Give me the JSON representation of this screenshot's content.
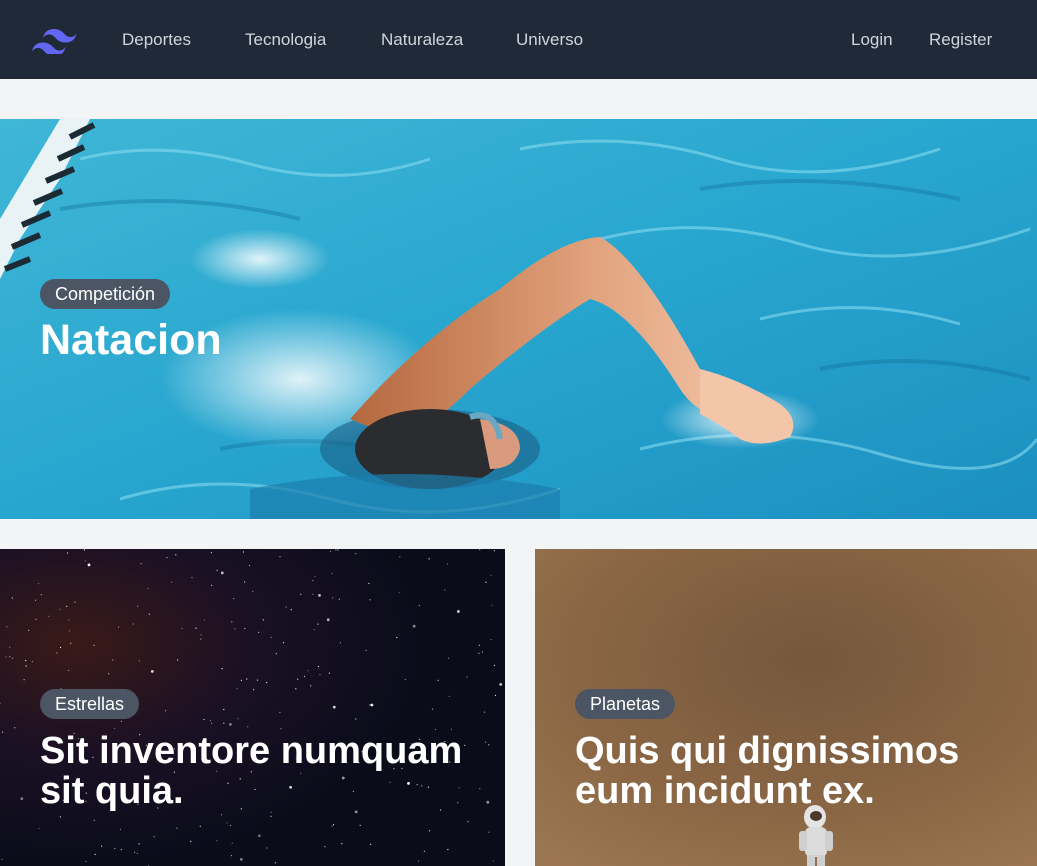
{
  "navbar": {
    "logo_icon": "tailwind-logo-icon",
    "links": [
      {
        "label": "Deportes"
      },
      {
        "label": "Tecnologia"
      },
      {
        "label": "Naturaleza"
      },
      {
        "label": "Universo"
      }
    ],
    "auth": {
      "login": "Login",
      "register": "Register"
    }
  },
  "hero": {
    "category": "Competición",
    "title": "Natacion",
    "image": "swimmer-in-pool-photo"
  },
  "cards": [
    {
      "category": "Estrellas",
      "title": "Sit inventore numquam sit quia.",
      "image": "starry-night-sky-photo"
    },
    {
      "category": "Planetas",
      "title": "Quis qui dignissimos eum incidunt ex.",
      "image": "astronaut-on-planet-photo"
    }
  ],
  "colors": {
    "nav_bg": "#1f2937",
    "page_bg": "#f3f4f6",
    "badge_bg": "#4b5563",
    "logo": "#6366f1"
  }
}
